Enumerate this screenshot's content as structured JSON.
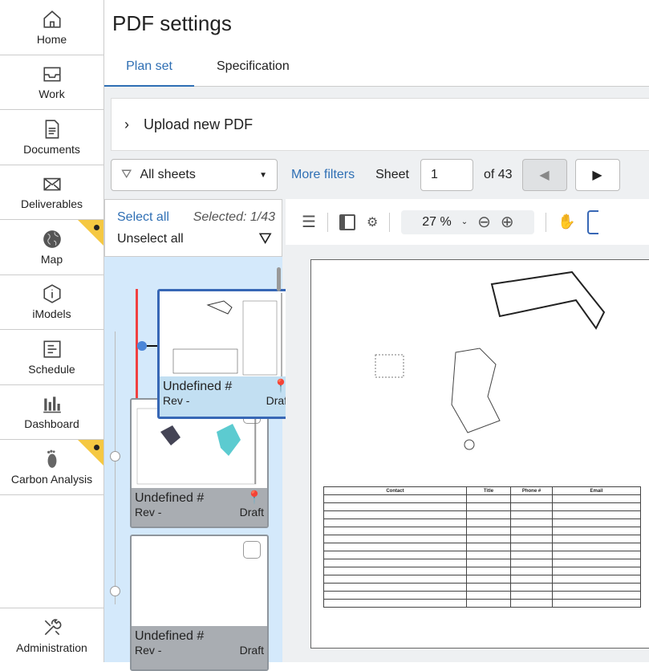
{
  "sidebar": {
    "items": [
      {
        "label": "Home"
      },
      {
        "label": "Work"
      },
      {
        "label": "Documents"
      },
      {
        "label": "Deliverables"
      },
      {
        "label": "Map"
      },
      {
        "label": "iModels"
      },
      {
        "label": "Schedule"
      },
      {
        "label": "Dashboard"
      },
      {
        "label": "Carbon Analysis"
      }
    ],
    "admin": "Administration"
  },
  "header": {
    "title": "PDF settings",
    "tabs": [
      "Plan set",
      "Specification"
    ]
  },
  "upload": {
    "label": "Upload new PDF"
  },
  "filters": {
    "select": "All sheets",
    "more": "More filters",
    "sheet_label": "Sheet",
    "sheet_value": "1",
    "of": "of 43"
  },
  "list": {
    "select_all": "Select all",
    "selected": "Selected: 1/43",
    "unselect_all": "Unselect all",
    "cards": [
      {
        "name": "Undefined #",
        "rev": "Rev -",
        "status": "Draft"
      },
      {
        "name": "Undefined #",
        "rev": "Rev -",
        "status": "Draft"
      },
      {
        "name": "Undefined #",
        "rev": "Rev -",
        "status": "Draft"
      }
    ]
  },
  "viewer": {
    "zoom": "27 %",
    "table_headers": [
      "Contact",
      "Title",
      "Phone #",
      "Email"
    ]
  },
  "colors": {
    "accent": "#2f6fb4",
    "badge": "#f5c842",
    "selected_bg": "#c2dff2"
  }
}
